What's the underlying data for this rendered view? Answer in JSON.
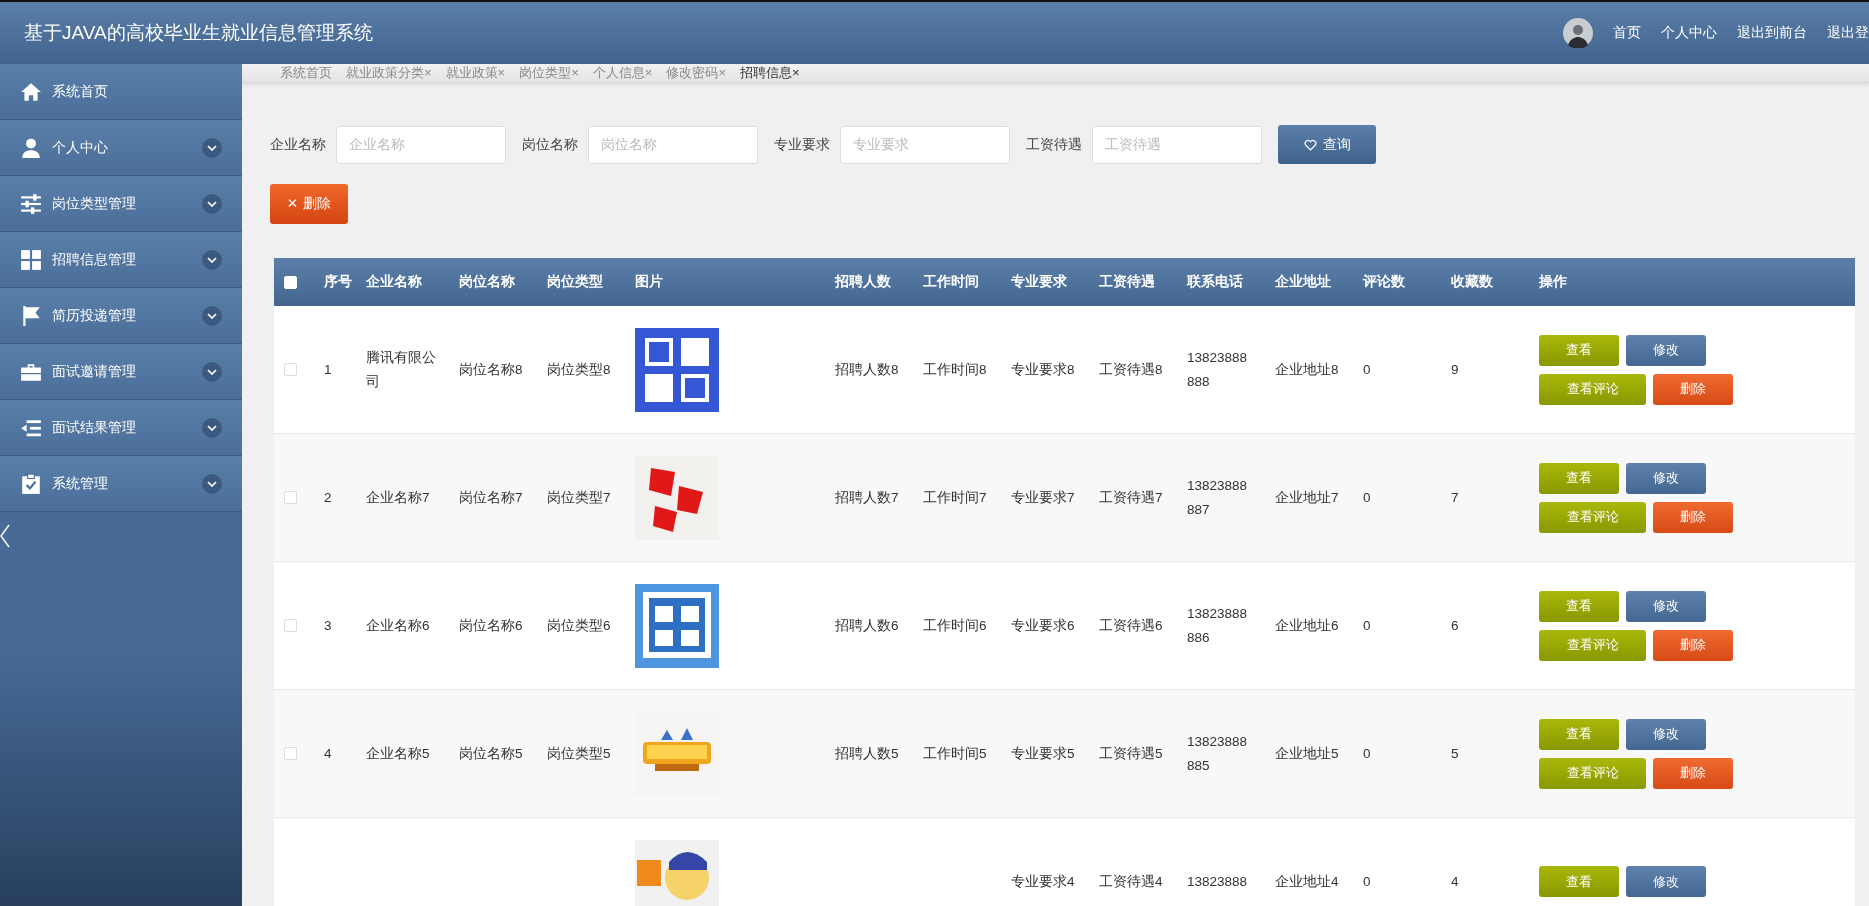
{
  "header": {
    "title": "基于JAVA的高校毕业生就业信息管理系统",
    "nav": [
      "首页",
      "个人中心",
      "退出到前台",
      "退出登"
    ]
  },
  "sidebar": {
    "items": [
      {
        "label": "系统首页",
        "expandable": false
      },
      {
        "label": "个人中心",
        "expandable": true
      },
      {
        "label": "岗位类型管理",
        "expandable": true
      },
      {
        "label": "招聘信息管理",
        "expandable": true
      },
      {
        "label": "简历投递管理",
        "expandable": true
      },
      {
        "label": "面试邀请管理",
        "expandable": true
      },
      {
        "label": "面试结果管理",
        "expandable": true
      },
      {
        "label": "系统管理",
        "expandable": true
      }
    ]
  },
  "tabs": [
    {
      "label": "系统首页",
      "selected": false
    },
    {
      "label": "就业政策分类",
      "close": "×",
      "selected": false
    },
    {
      "label": "就业政策",
      "close": "×",
      "selected": false
    },
    {
      "label": "岗位类型",
      "close": "×",
      "selected": false
    },
    {
      "label": "个人信息",
      "close": "×",
      "selected": false
    },
    {
      "label": "修改密码",
      "close": "×",
      "selected": false
    },
    {
      "label": "招聘信息",
      "close": "×",
      "selected": true
    }
  ],
  "search": {
    "fields": [
      {
        "label": "企业名称",
        "placeholder": "企业名称"
      },
      {
        "label": "岗位名称",
        "placeholder": "岗位名称"
      },
      {
        "label": "专业要求",
        "placeholder": "专业要求"
      },
      {
        "label": "工资待遇",
        "placeholder": "工资待遇"
      }
    ],
    "button": "查询"
  },
  "delete_button": {
    "icon": "✕",
    "label": "删除"
  },
  "table": {
    "header_checked": false,
    "columns": [
      "序号",
      "企业名称",
      "岗位名称",
      "岗位类型",
      "图片",
      "招聘人数",
      "工作时间",
      "专业要求",
      "工资待遇",
      "联系电话",
      "企业地址",
      "评论数",
      "收藏数",
      "操作"
    ],
    "rows": [
      {
        "checked": false,
        "cells": [
          "1",
          "腾讯有限公司",
          "岗位名称8",
          "岗位类型8",
          null,
          "招聘人数8",
          "工作时间8",
          "专业要求8",
          "工资待遇8",
          "13823888888",
          "企业地址8",
          "0",
          "9"
        ],
        "actions": [
          {
            "kind": "view",
            "label": "查看"
          },
          {
            "kind": "edit",
            "label": "修改"
          },
          {
            "kind": "comments",
            "label": "查看评论"
          },
          {
            "kind": "delete",
            "label": "删除"
          }
        ]
      },
      {
        "checked": false,
        "cells": [
          "2",
          "企业名称7",
          "岗位名称7",
          "岗位类型7",
          null,
          "招聘人数7",
          "工作时间7",
          "专业要求7",
          "工资待遇7",
          "13823888887",
          "企业地址7",
          "0",
          "7"
        ],
        "actions": [
          {
            "kind": "view",
            "label": "查看"
          },
          {
            "kind": "edit",
            "label": "修改"
          },
          {
            "kind": "comments",
            "label": "查看评论"
          },
          {
            "kind": "delete",
            "label": "删除"
          }
        ]
      },
      {
        "checked": false,
        "cells": [
          "3",
          "企业名称6",
          "岗位名称6",
          "岗位类型6",
          null,
          "招聘人数6",
          "工作时间6",
          "专业要求6",
          "工资待遇6",
          "13823888886",
          "企业地址6",
          "0",
          "6"
        ],
        "actions": [
          {
            "kind": "view",
            "label": "查看"
          },
          {
            "kind": "edit",
            "label": "修改"
          },
          {
            "kind": "comments",
            "label": "查看评论"
          },
          {
            "kind": "delete",
            "label": "删除"
          }
        ]
      },
      {
        "checked": false,
        "cells": [
          "4",
          "企业名称5",
          "岗位名称5",
          "岗位类型5",
          null,
          "招聘人数5",
          "工作时间5",
          "专业要求5",
          "工资待遇5",
          "13823888885",
          "企业地址5",
          "0",
          "5"
        ],
        "actions": [
          {
            "kind": "view",
            "label": "查看"
          },
          {
            "kind": "edit",
            "label": "修改"
          },
          {
            "kind": "comments",
            "label": "查看评论"
          },
          {
            "kind": "delete",
            "label": "删除"
          }
        ]
      },
      {
        "cells": [
          null,
          null,
          null,
          null,
          null,
          null,
          null,
          "专业要求4",
          "工资待遇4",
          "13823888",
          "企业地址4",
          "0",
          "4"
        ],
        "actions": [
          {
            "kind": "view",
            "label": "查看"
          },
          {
            "kind": "edit",
            "label": "修改"
          }
        ]
      }
    ]
  }
}
